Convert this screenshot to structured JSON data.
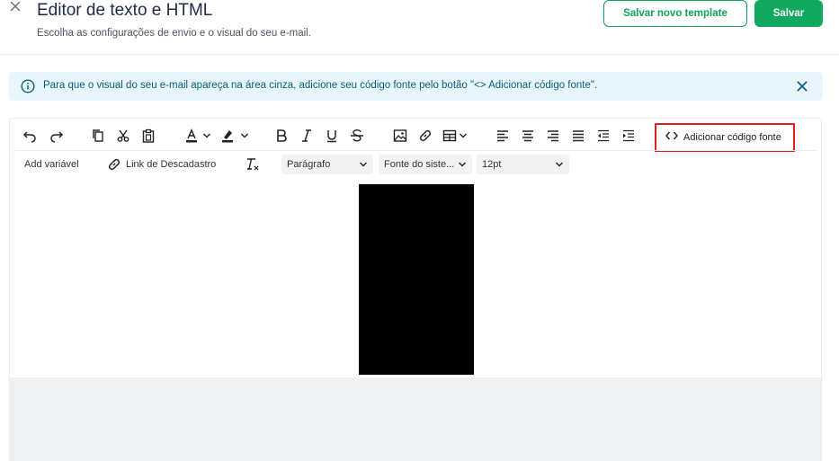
{
  "header": {
    "title": "Editor de texto e HTML",
    "subtitle": "Escolha as configurações de envio e o visual do seu e-mail.",
    "save_template_label": "Salvar novo template",
    "save_label": "Salvar"
  },
  "alert": {
    "text": "Para que o visual do seu e-mail apareça na área cinza, adicione seu código fonte pelo botão \"<> Adicionar código fonte\"."
  },
  "toolbar": {
    "source_code_label": "Adicionar código fonte",
    "add_variable_label": "Add variável",
    "unsubscribe_link_label": "Link de Descadastro",
    "block_format_value": "Parágrafo",
    "font_family_value": "Fonte do siste...",
    "font_size_value": "12pt"
  },
  "colors": {
    "primary_green": "#11a85f",
    "alert_background": "#e8f6fb",
    "alert_text": "#0d5d7a",
    "highlight_border": "#e02020"
  }
}
